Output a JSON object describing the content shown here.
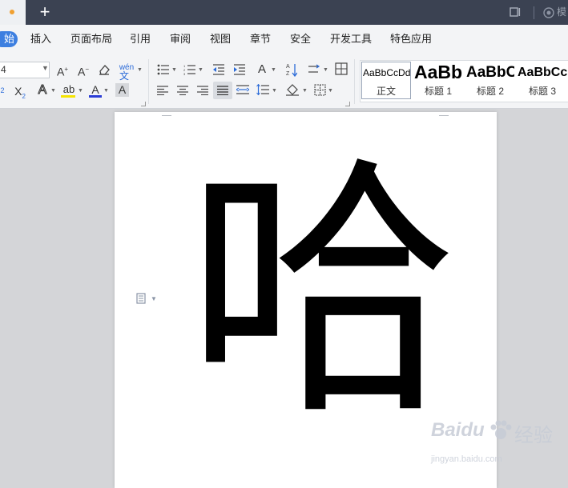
{
  "titlebar": {
    "new_tab": "+",
    "right_text": "模"
  },
  "menu": {
    "active": "始",
    "items": [
      "插入",
      "页面布局",
      "引用",
      "审阅",
      "视图",
      "章节",
      "安全",
      "开发工具",
      "特色应用"
    ]
  },
  "ribbon": {
    "font_size": "4",
    "buttons": {
      "grow": "A",
      "shrink": "A",
      "pinyin": "wén",
      "sub": "X",
      "outline": "A",
      "highlight": "ab",
      "font_color": "A",
      "shade": "A"
    },
    "accent": "#3d7fe0",
    "highlight_color": "#f5e400",
    "font_color_bar": "#2b3dd6"
  },
  "styles": [
    {
      "sample": "AaBbCcDd",
      "label": "正文"
    },
    {
      "sample": "AaBb",
      "label": "标题 1"
    },
    {
      "sample": "AaBbC",
      "label": "标题 2"
    },
    {
      "sample": "AaBbCc",
      "label": "标题 3"
    }
  ],
  "document": {
    "character": "哈"
  },
  "watermark": {
    "brand": "Baidu",
    "brand_cn": "经验",
    "url": "jingyan.baidu.com"
  }
}
